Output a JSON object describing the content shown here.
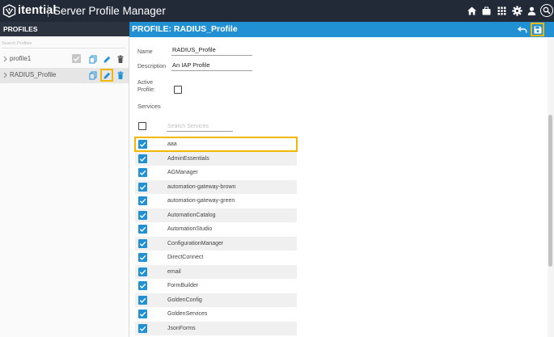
{
  "app": {
    "brand": "itential",
    "title": "Server Profile Manager",
    "icons": [
      "home-icon",
      "briefcase-icon",
      "apps-grid-icon",
      "settings-gear-icon",
      "user-icon",
      "search-icon"
    ]
  },
  "sidebar": {
    "header": "PROFILES",
    "search_placeholder": "Search Profiles",
    "profiles": [
      {
        "label": "profile1",
        "active": true,
        "selected": false
      },
      {
        "label": "RADIUS_Profile",
        "active": false,
        "selected": true
      }
    ]
  },
  "main": {
    "title": "PROFILE: RADIUS_Profile",
    "form": {
      "name_label": "Name",
      "name_value": "RADIUS_Profile",
      "description_label": "Description",
      "description_value": "An IAP Profile",
      "active_label_line1": "Active",
      "active_label_line2": "Profile:",
      "active_checked": false
    },
    "services": {
      "label": "Services",
      "search_placeholder": "Search Services",
      "select_all_checked": false,
      "items": [
        {
          "name": "aaa",
          "checked": true
        },
        {
          "name": "AdminEssentials",
          "checked": true
        },
        {
          "name": "AGManager",
          "checked": true
        },
        {
          "name": "automation-gateway-brown",
          "checked": true
        },
        {
          "name": "automation-gateway-green",
          "checked": true
        },
        {
          "name": "AutomationCatalog",
          "checked": true
        },
        {
          "name": "AutomationStudio",
          "checked": true
        },
        {
          "name": "ConfigurationManager",
          "checked": true
        },
        {
          "name": "DirectConnect",
          "checked": true
        },
        {
          "name": "email",
          "checked": true
        },
        {
          "name": "FormBuilder",
          "checked": true
        },
        {
          "name": "GoldenConfig",
          "checked": true
        },
        {
          "name": "GoldenServices",
          "checked": true
        },
        {
          "name": "JsonForms",
          "checked": true
        }
      ]
    }
  },
  "colors": {
    "topbar": "#222a37",
    "accent_blue": "#2291d4",
    "highlight_yellow": "#f2b705"
  }
}
